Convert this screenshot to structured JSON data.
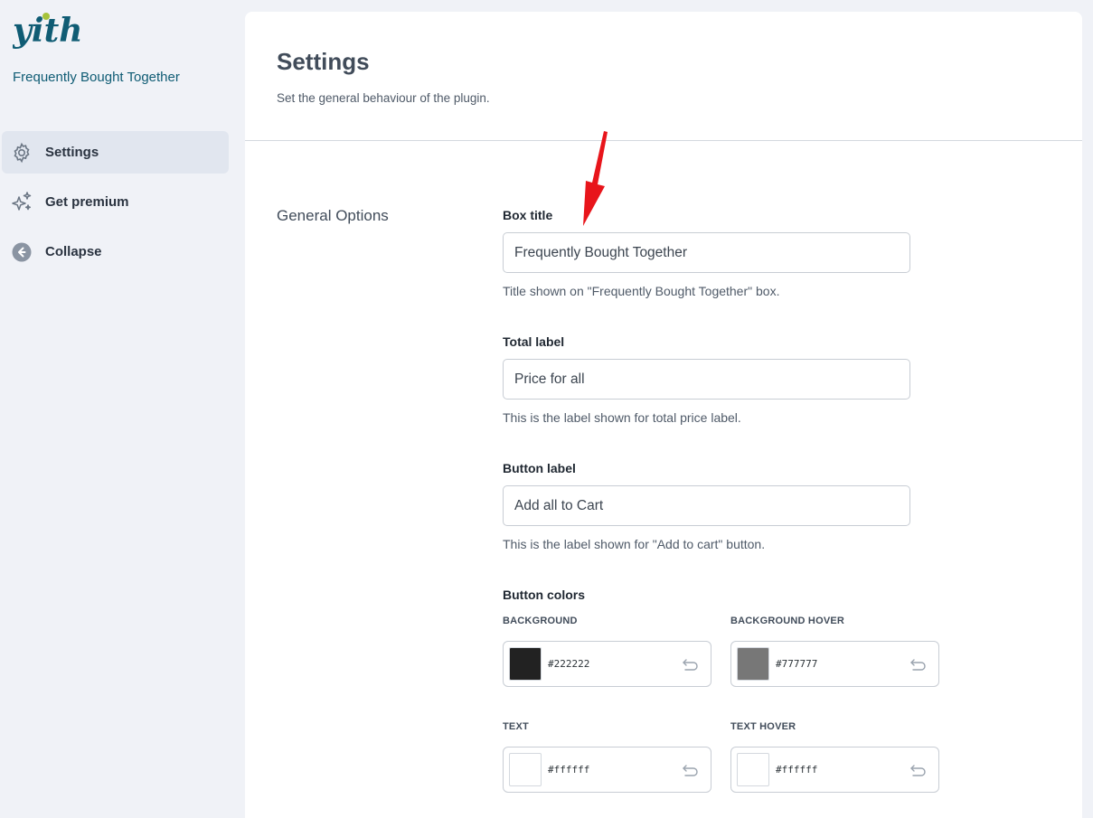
{
  "sidebar": {
    "logo_text": "yith",
    "plugin_name": "Frequently Bought Together",
    "items": [
      {
        "label": "Settings",
        "icon": "gear-icon",
        "active": true
      },
      {
        "label": "Get premium",
        "icon": "sparkles-icon",
        "active": false
      },
      {
        "label": "Collapse",
        "icon": "arrow-left-circle-icon",
        "active": false
      }
    ]
  },
  "header": {
    "title": "Settings",
    "subtitle": "Set the general behaviour of the plugin."
  },
  "section": {
    "title": "General Options",
    "box_title": {
      "label": "Box title",
      "value": "Frequently Bought Together",
      "description": "Title shown on \"Frequently Bought Together\" box."
    },
    "total_label": {
      "label": "Total label",
      "value": "Price for all",
      "description": "This is the label shown for total price label."
    },
    "button_label": {
      "label": "Button label",
      "value": "Add all to Cart",
      "description": "This is the label shown for \"Add to cart\" button."
    },
    "button_colors": {
      "label": "Button colors",
      "background": {
        "caption": "BACKGROUND",
        "value": "#222222",
        "color": "#222222"
      },
      "background_hover": {
        "caption": "BACKGROUND HOVER",
        "value": "#777777",
        "color": "#777777"
      },
      "text": {
        "caption": "TEXT",
        "value": "#ffffff",
        "color": "#ffffff"
      },
      "text_hover": {
        "caption": "TEXT HOVER",
        "value": "#ffffff",
        "color": "#ffffff"
      }
    }
  },
  "colors": {
    "brand": "#0f5c74",
    "accent_green": "#a6c33b",
    "annotation_arrow": "#e8151b"
  }
}
